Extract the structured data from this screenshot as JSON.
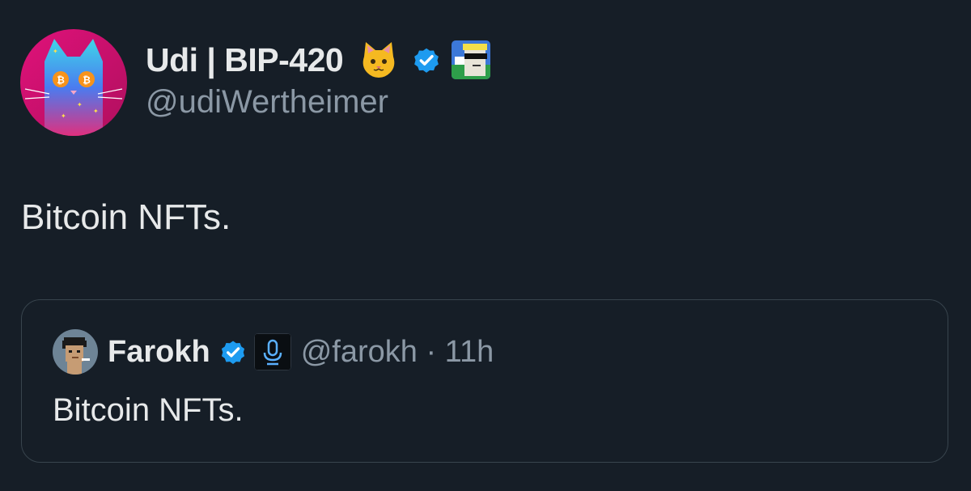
{
  "author": {
    "display_name": "Udi | BIP-420",
    "handle": "@udiWertheimer",
    "emoji_icon": "cat-face-icon",
    "verified_icon": "verified-badge-icon",
    "affiliation_icon": "affiliation-badge-icon"
  },
  "tweet": {
    "text": "Bitcoin NFTs."
  },
  "quoted_tweet": {
    "display_name": "Farokh",
    "handle_time": "@farokh · 11h",
    "text": "Bitcoin NFTs.",
    "verified_icon": "verified-badge-icon",
    "affiliation_icon": "microphone-badge-icon"
  },
  "colors": {
    "background": "#161e27",
    "primary_text": "#e7e9ea",
    "secondary_text": "#8b98a5",
    "verified_blue": "#1d9bf0",
    "border": "#38444d"
  }
}
